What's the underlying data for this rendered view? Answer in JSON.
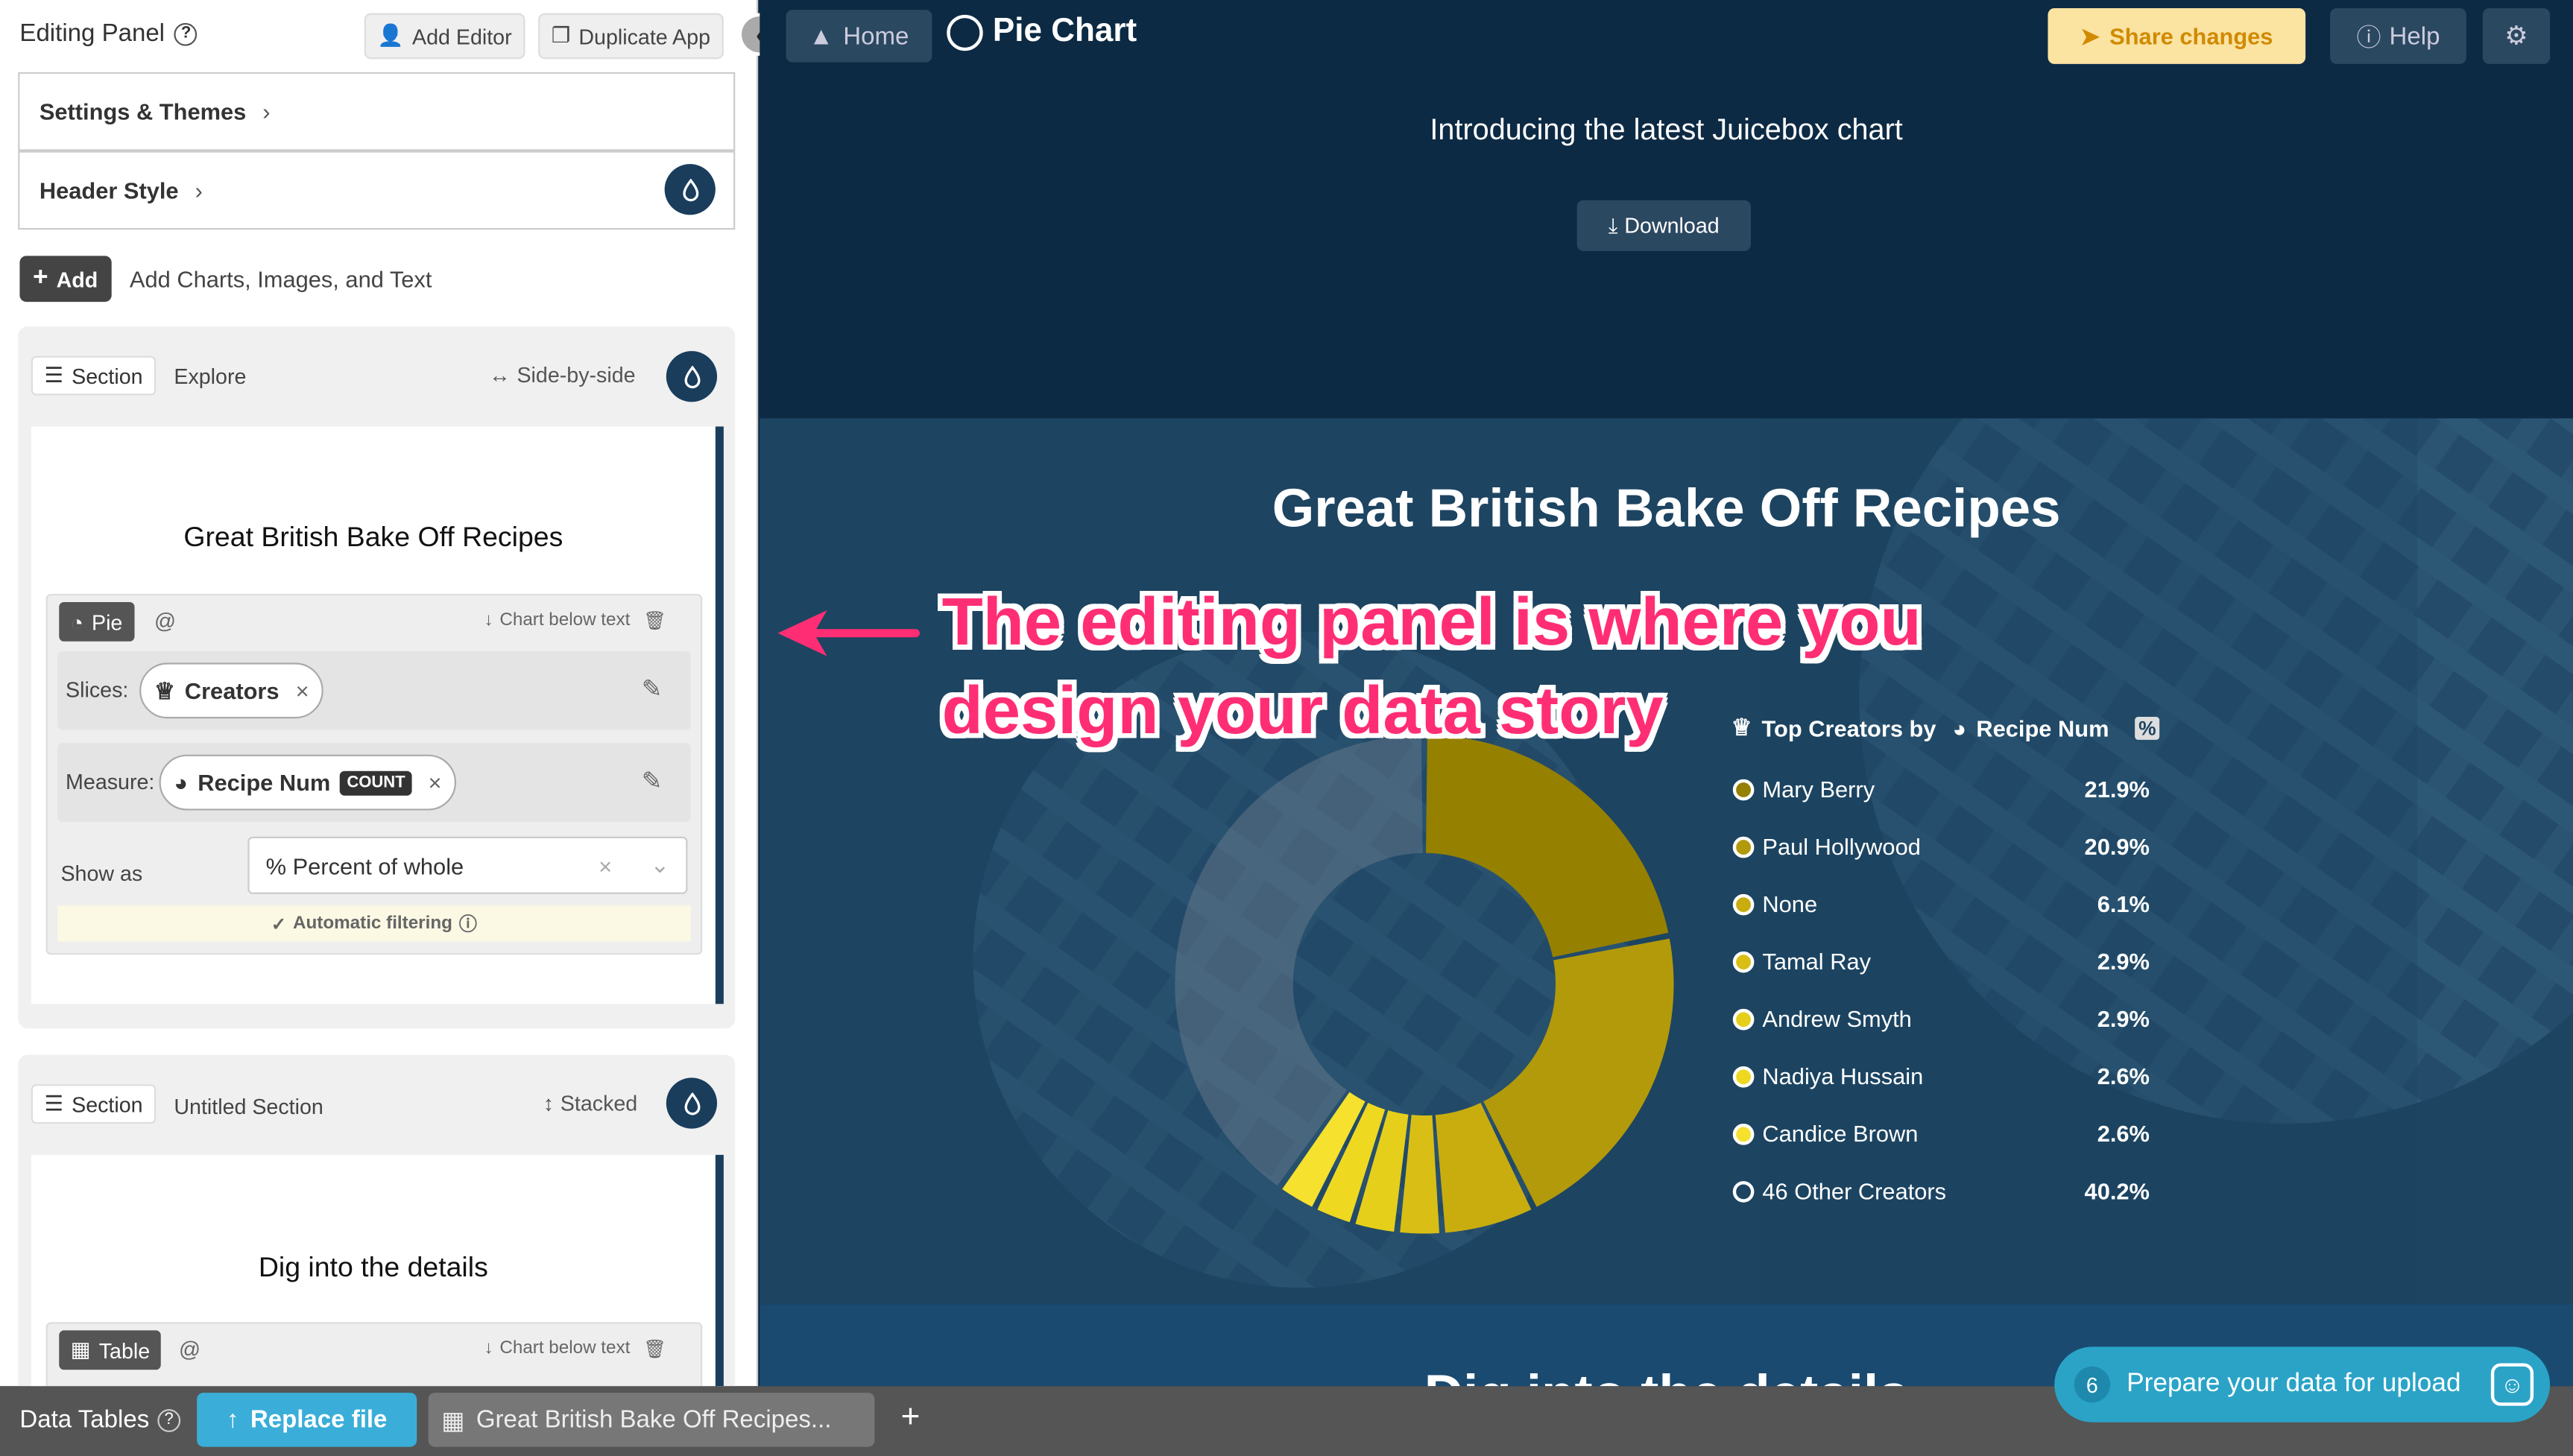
{
  "panel": {
    "title": "Editing Panel",
    "add_editor": "Add Editor",
    "duplicate_app": "Duplicate App",
    "settings_themes": "Settings & Themes",
    "header_style": "Header Style",
    "add_button": "Add",
    "add_hint": "Add Charts, Images, and Text",
    "section1": {
      "tag": "Section",
      "name": "Explore",
      "layout": "Side-by-side",
      "heading": "Great British Bake Off Recipes",
      "chart_type": "Pie",
      "at": "@",
      "position": "Chart below text",
      "slices_label": "Slices:",
      "slices_value": "Creators",
      "measure_label": "Measure:",
      "measure_value": "Recipe Num",
      "measure_badge": "COUNT",
      "show_as_label": "Show as",
      "show_as_value": "% Percent of whole",
      "auto_filter": "Automatic filtering"
    },
    "section2": {
      "tag": "Section",
      "name": "Untitled Section",
      "layout": "Stacked",
      "heading": "Dig into the details",
      "chart_type": "Table",
      "at": "@",
      "position": "Chart below text"
    }
  },
  "topbar": {
    "home": "Home",
    "app_title": "Pie Chart",
    "share": "Share changes",
    "help": "Help"
  },
  "header": {
    "intro": "Introducing the latest Juicebox chart",
    "download": "Download"
  },
  "hero": {
    "title": "Great British Bake Off Recipes",
    "annotation_line1": "The editing panel is where you",
    "annotation_line2": "design your data story",
    "below_title": "Dig into the details"
  },
  "chart_data": {
    "type": "pie",
    "legend_title_prefix": "Top Creators by",
    "legend_measure": "Recipe Num",
    "categories": [
      "Mary Berry",
      "Paul Hollywood",
      "None",
      "Tamal Ray",
      "Andrew Smyth",
      "Nadiya Hussain",
      "Candice Brown",
      "46 Other Creators"
    ],
    "values": [
      21.9,
      20.9,
      6.1,
      2.9,
      2.9,
      2.6,
      2.6,
      40.2
    ],
    "labels": [
      "21.9%",
      "20.9%",
      "6.1%",
      "2.9%",
      "2.9%",
      "2.6%",
      "2.6%",
      "40.2%"
    ],
    "colors": [
      "#958000",
      "#b39a0b",
      "#c9ad0f",
      "#d9bf15",
      "#e6cf1a",
      "#efd920",
      "#f5e12e",
      "#6e7f8e"
    ]
  },
  "bottombar": {
    "data_tables": "Data Tables",
    "replace_file": "Replace file",
    "file_tab": "Great British Bake Off Recipes...",
    "add_tab": "+",
    "prepare_count": "6",
    "prepare_text": "Prepare your data for upload"
  }
}
